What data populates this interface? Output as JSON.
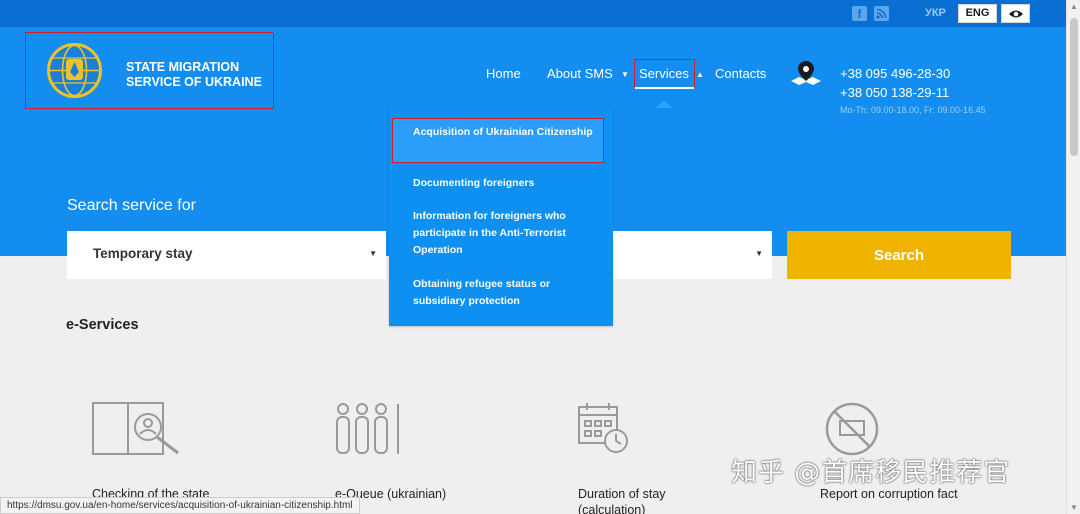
{
  "topbar": {
    "social_icons": [
      "facebook-icon",
      "rss-icon"
    ],
    "lang_ukr": "УКР",
    "lang_eng": "ENG",
    "accessibility_icon": "eye-icon"
  },
  "logo": {
    "line1": "STATE MIGRATION",
    "line2": "SERVICE OF UKRAINE"
  },
  "nav": {
    "home": "Home",
    "about": "About SMS",
    "services": "Services",
    "contacts": "Contacts"
  },
  "contact": {
    "phone1": "+38 095 496-28-30",
    "phone2": "+38 050 138-29-11",
    "hours": "Mo-Th: 09.00-18.00, Fr: 09.00-16.45"
  },
  "dropdown": {
    "items": [
      "Acquisition of Ukrainian Citizenship",
      "Documenting foreigners",
      "Information for foreigners who participate in the Anti-Terrorist Operation",
      "Obtaining refugee status or subsidiary protection"
    ]
  },
  "search": {
    "label": "Search service for",
    "select_value": "Temporary stay",
    "button": "Search"
  },
  "eservices": {
    "title": "e-Services",
    "cards": [
      {
        "label": "Checking of the state",
        "icon": "passport-check-icon"
      },
      {
        "label": "e-Queue (ukrainian)",
        "icon": "queue-people-icon"
      },
      {
        "label": "Duration of stay (calculation)",
        "icon": "calendar-clock-icon"
      },
      {
        "label": "Report on corruption fact",
        "icon": "no-corruption-icon"
      }
    ]
  },
  "status_url": "https://dmsu.gov.ua/en-home/services/acquisition-of-ukrainian-citizenship.html",
  "watermark": "知乎 @首席移民推荐官",
  "colors": {
    "hero": "#138ef0",
    "topbar": "#0a6fd3",
    "search_button": "#f0b400",
    "dropdown": "#0e8ff2",
    "highlight_border": "#d1202c"
  }
}
